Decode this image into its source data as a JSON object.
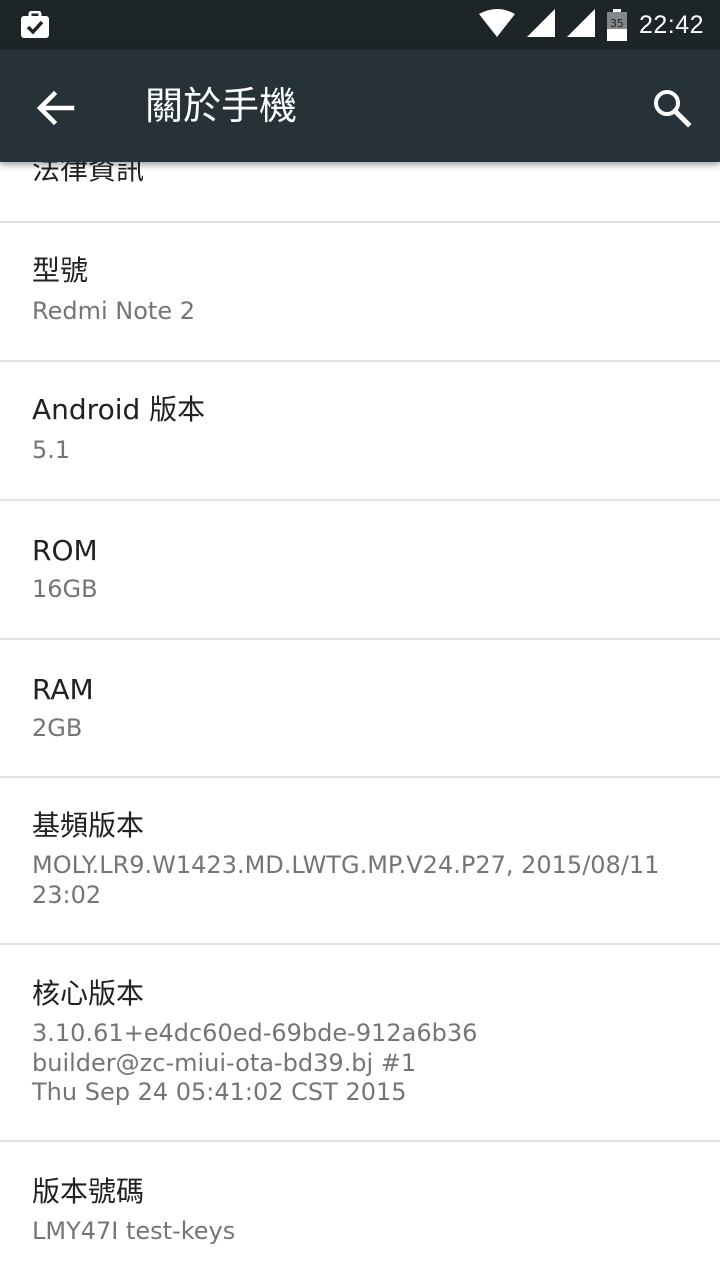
{
  "status_bar": {
    "time": "22:42",
    "battery_level": "35",
    "icons": [
      "clipboard-check-icon",
      "wifi-icon",
      "signal-icon",
      "signal-icon",
      "battery-icon"
    ]
  },
  "app_bar": {
    "title": "關於手機",
    "back_icon": "arrow-back-icon",
    "search_icon": "search-icon"
  },
  "list": {
    "partial_item_title": "法律資訊",
    "items": [
      {
        "title": "型號",
        "summary": "Redmi Note 2"
      },
      {
        "title": "Android 版本",
        "summary": "5.1"
      },
      {
        "title": "ROM",
        "summary": "16GB"
      },
      {
        "title": "RAM",
        "summary": "2GB"
      },
      {
        "title": "基頻版本",
        "summary": "MOLY.LR9.W1423.MD.LWTG.MP.V24.P27, 2015/08/11\n23:02"
      },
      {
        "title": "核心版本",
        "summary": "3.10.61+e4dc60ed-69bde-912a6b36\nbuilder@zc-miui-ota-bd39.bj #1\nThu Sep 24 05:41:02 CST 2015"
      },
      {
        "title": "版本號碼",
        "summary": "LMY47I test-keys"
      }
    ]
  },
  "colors": {
    "status_bar": "#1e2529",
    "app_bar": "#263238",
    "title_text": "#212121",
    "summary_text": "#757575",
    "divider": "#e2e2e2"
  }
}
